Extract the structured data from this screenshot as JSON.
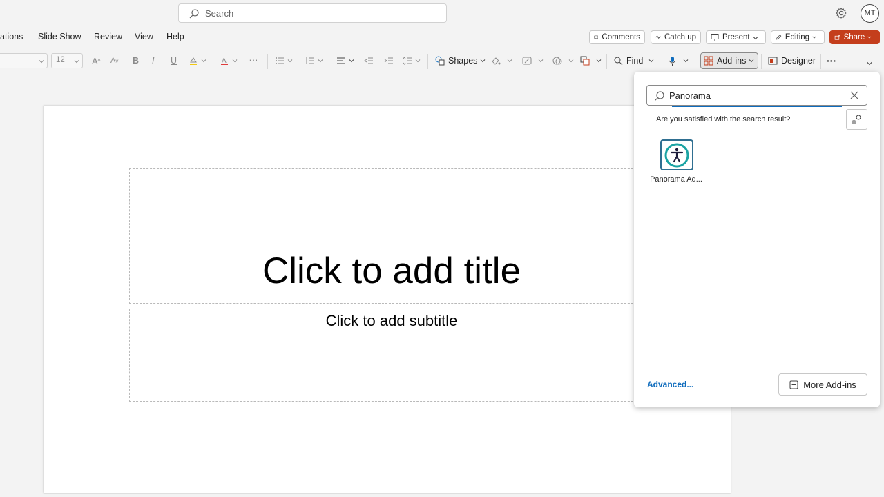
{
  "search": {
    "placeholder": "Search"
  },
  "user": {
    "initials": "MT"
  },
  "menu": {
    "items": [
      "ations",
      "Slide Show",
      "Review",
      "View",
      "Help"
    ]
  },
  "actions": {
    "comments": "Comments",
    "catch_up": "Catch up",
    "present": "Present",
    "editing": "Editing",
    "share": "Share"
  },
  "ribbon": {
    "font_size": "12",
    "shapes": "Shapes",
    "find": "Find",
    "addins": "Add-ins",
    "designer": "Designer"
  },
  "slide": {
    "title_placeholder": "Click to add title",
    "subtitle_placeholder": "Click to add subtitle"
  },
  "addins_panel": {
    "search_value": "Panorama",
    "feedback_question": "Are you satisfied with the search result?",
    "results": [
      {
        "name": "Panorama Ad..."
      }
    ],
    "advanced_link": "Advanced...",
    "more_addins": "More Add-ins"
  },
  "colors": {
    "accent": "#0f6cbd",
    "share_bg": "#c43e1c",
    "addin_icon": "#2f6f91",
    "font_color_swatch": "#e03b3b"
  }
}
